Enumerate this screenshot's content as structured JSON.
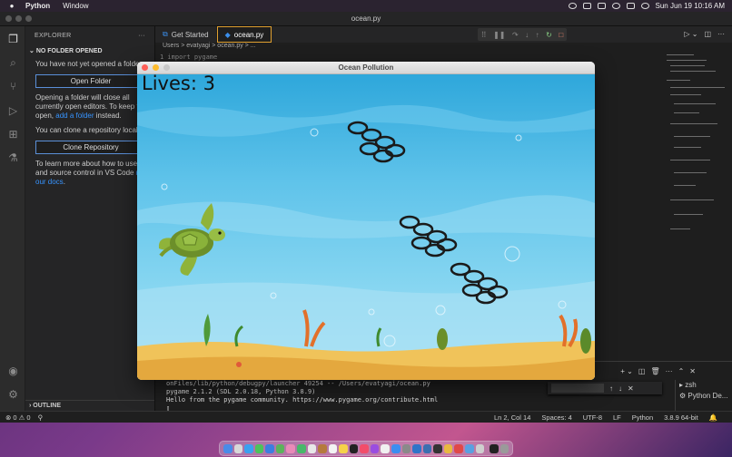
{
  "menubar": {
    "app": "Python",
    "menus": [
      "Window"
    ],
    "clock": "Sun Jun 19  10:16 AM"
  },
  "window": {
    "title": "ocean.py"
  },
  "sidebar": {
    "header": "EXPLORER",
    "more": "···",
    "section": "NO FOLDER OPENED",
    "text1": "You have not yet opened a folder.",
    "open_folder": "Open Folder",
    "text2a": "Opening a folder will close all currently open editors. To keep them open, ",
    "text2_link": "add a folder",
    "text2b": " instead.",
    "text3": "You can clone a repository locally.",
    "clone": "Clone Repository",
    "text4a": "To learn more about how to use git and source control in VS Code ",
    "text4_link": "read our docs",
    "text4b": ".",
    "outline": "OUTLINE"
  },
  "tabs": [
    {
      "label": "Get Started"
    },
    {
      "label": "ocean.py"
    }
  ],
  "breadcrumbs": "Users  >  evatyagi  >  ocean.py  >  ...",
  "code_line": "1    import pygame",
  "terminal": {
    "lines": [
      "onFiles/lib/python/debugpy/launcher 49254 -- /Users/evatyagi/ocean.py",
      "pygame 2.1.2 (SDL 2.0.18, Python 3.8.9)",
      "Hello from the pygame community. https://www.pygame.org/contribute.html",
      "▯"
    ],
    "list": [
      "zsh",
      "Python De..."
    ]
  },
  "statusbar": {
    "problems": "⊗ 0  ⚠ 0",
    "position": "Ln 2, Col 14",
    "spaces": "Spaces: 4",
    "encoding": "UTF-8",
    "eol": "LF",
    "language": "Python",
    "interpreter": "3.8.9 64-bit"
  },
  "game": {
    "title": "Ocean Pollution",
    "lives_text": "Lives: 3",
    "colors": {
      "sky": "#3fb2e0",
      "water": "#7fd3ef",
      "sand": "#f0c35a",
      "turtle": "#7a9a2a"
    }
  }
}
